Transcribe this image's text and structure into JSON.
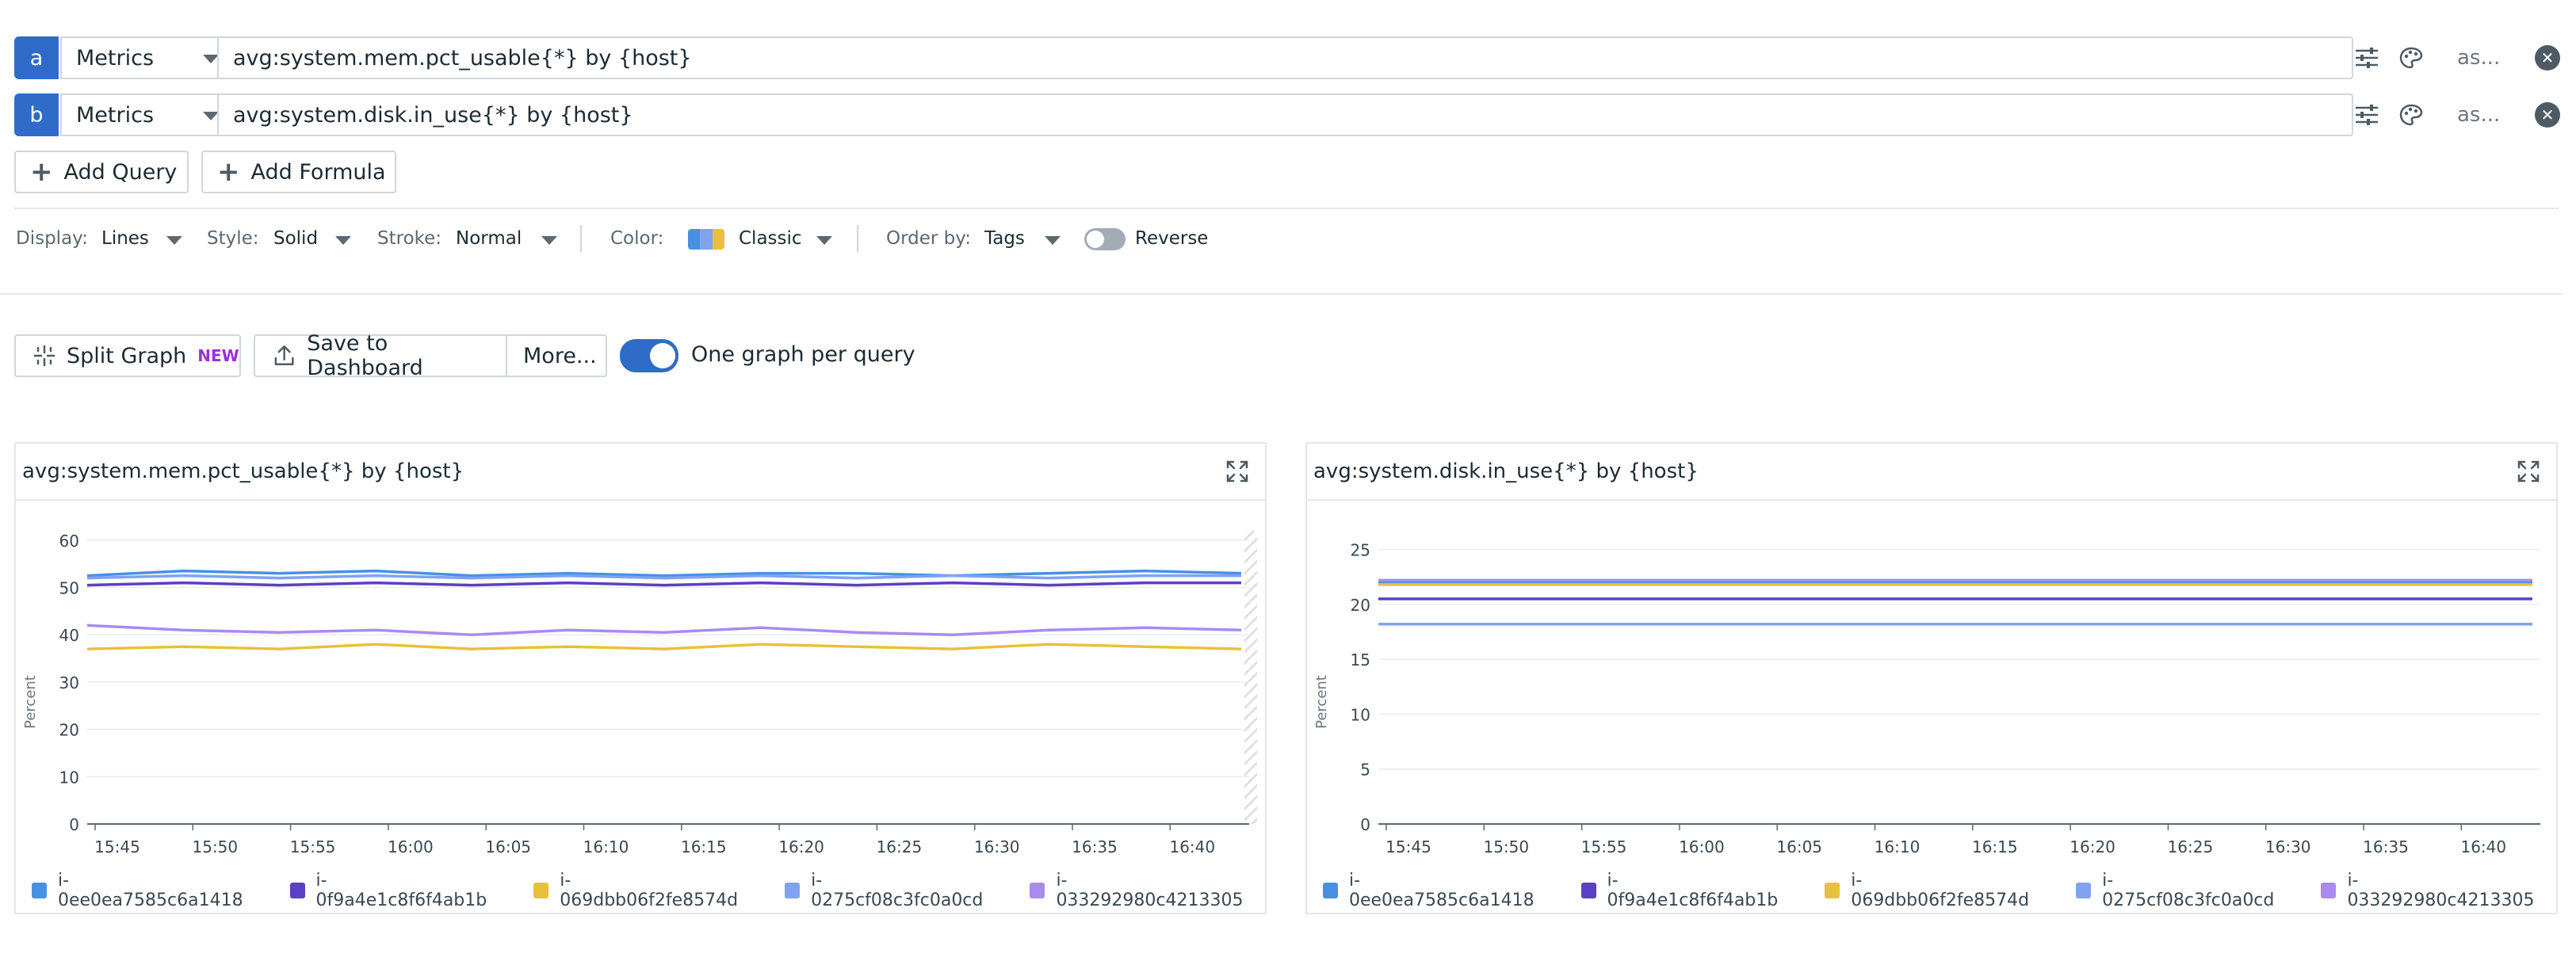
{
  "queries": [
    {
      "letter": "a",
      "source": "Metrics",
      "expression": "avg:system.mem.pct_usable{*} by {host}",
      "alias": "as..."
    },
    {
      "letter": "b",
      "source": "Metrics",
      "expression": "avg:system.disk.in_use{*} by {host}",
      "alias": "as..."
    }
  ],
  "actions": {
    "add_query": "Add Query",
    "add_formula": "Add Formula"
  },
  "display_options": {
    "display_label": "Display:",
    "display_value": "Lines",
    "style_label": "Style:",
    "style_value": "Solid",
    "stroke_label": "Stroke:",
    "stroke_value": "Normal",
    "color_label": "Color:",
    "color_value": "Classic",
    "order_label": "Order by:",
    "order_value": "Tags",
    "reverse_label": "Reverse",
    "reverse_on": false
  },
  "toolbar": {
    "split_graph": "Split Graph",
    "split_badge": "NEW",
    "save_dashboard": "Save to Dashboard",
    "more": "More...",
    "one_graph_label": "One graph per query",
    "one_graph_on": true
  },
  "colors": {
    "accent": "#2f6cc9",
    "badge": "#9b30d9",
    "series": [
      "#4a90e2",
      "#5b3fc4",
      "#e8c13a",
      "#7fa3ee",
      "#a98bf0"
    ]
  },
  "chart_data": [
    {
      "type": "line",
      "title": "avg:system.mem.pct_usable{*} by {host}",
      "ylabel": "Percent",
      "ylim": [
        0,
        65
      ],
      "yticks": [
        0,
        10,
        20,
        30,
        40,
        50,
        60
      ],
      "xticks": [
        "15:45",
        "15:50",
        "15:55",
        "16:00",
        "16:05",
        "16:10",
        "16:15",
        "16:20",
        "16:25",
        "16:30",
        "16:35",
        "16:40"
      ],
      "series": [
        {
          "name": "i-0ee0ea7585c6a1418",
          "values": [
            52.5,
            53.5,
            53,
            53.5,
            52.5,
            53,
            52.5,
            53,
            53,
            52.5,
            53,
            53.5,
            53
          ]
        },
        {
          "name": "i-0f9a4e1c8f6f4ab1b",
          "values": [
            50.5,
            51,
            50.5,
            51,
            50.5,
            51,
            50.5,
            51,
            50.5,
            51,
            50.5,
            51,
            51
          ]
        },
        {
          "name": "i-069dbb06f2fe8574d",
          "values": [
            37,
            37.5,
            37,
            38,
            37,
            37.5,
            37,
            38,
            37.5,
            37,
            38,
            37.5,
            37
          ]
        },
        {
          "name": "i-0275cf08c3fc0a0cd",
          "values": [
            52,
            52.5,
            52,
            52.5,
            52,
            52.5,
            52,
            52.5,
            52,
            52.5,
            52,
            52.5,
            52.5
          ]
        },
        {
          "name": "i-033292980c4213305",
          "values": [
            42,
            41,
            40.5,
            41,
            40,
            41,
            40.5,
            41.5,
            40.5,
            40,
            41,
            41.5,
            41
          ]
        }
      ]
    },
    {
      "type": "line",
      "title": "avg:system.disk.in_use{*} by {host}",
      "ylabel": "Percent",
      "ylim": [
        0,
        28
      ],
      "yticks": [
        0,
        5,
        10,
        15,
        20,
        25
      ],
      "xticks": [
        "15:45",
        "15:50",
        "15:55",
        "16:00",
        "16:05",
        "16:10",
        "16:15",
        "16:20",
        "16:25",
        "16:30",
        "16:35",
        "16:40"
      ],
      "series": [
        {
          "name": "i-0ee0ea7585c6a1418",
          "values": [
            22,
            22,
            22,
            22,
            22,
            22,
            22,
            22,
            22,
            22,
            22,
            22,
            22
          ]
        },
        {
          "name": "i-0f9a4e1c8f6f4ab1b",
          "values": [
            20.5,
            20.5,
            20.5,
            20.5,
            20.5,
            20.5,
            20.5,
            20.5,
            20.5,
            20.5,
            20.5,
            20.5,
            20.5
          ]
        },
        {
          "name": "i-069dbb06f2fe8574d",
          "values": [
            21.8,
            21.8,
            21.8,
            21.8,
            21.8,
            21.8,
            21.8,
            21.8,
            21.8,
            21.8,
            21.8,
            21.8,
            21.8
          ]
        },
        {
          "name": "i-0275cf08c3fc0a0cd",
          "values": [
            18.2,
            18.2,
            18.2,
            18.2,
            18.2,
            18.2,
            18.2,
            18.2,
            18.2,
            18.2,
            18.2,
            18.2,
            18.2
          ]
        },
        {
          "name": "i-033292980c4213305",
          "values": [
            22.2,
            22.2,
            22.2,
            22.2,
            22.2,
            22.2,
            22.2,
            22.2,
            22.2,
            22.2,
            22.2,
            22.2,
            22.2
          ]
        }
      ]
    }
  ]
}
